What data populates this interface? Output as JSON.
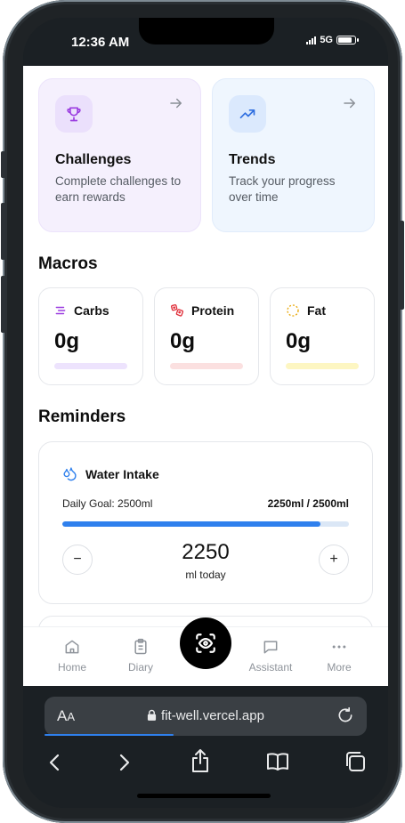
{
  "status": {
    "time": "12:36 AM",
    "network": "5G"
  },
  "features": [
    {
      "title": "Challenges",
      "description": "Complete challenges to earn rewards",
      "icon": "trophy-icon",
      "color": "#9b3ce0"
    },
    {
      "title": "Trends",
      "description": "Track your progress over time",
      "icon": "trending-up-icon",
      "color": "#2f6fe0"
    }
  ],
  "macros": {
    "title": "Macros",
    "items": [
      {
        "label": "Carbs",
        "value": "0g",
        "icon": "carbs-icon",
        "color": "#9b3ce0",
        "bar": "#ede3fd"
      },
      {
        "label": "Protein",
        "value": "0g",
        "icon": "protein-icon",
        "color": "#e0303b",
        "bar": "#fbe0e0"
      },
      {
        "label": "Fat",
        "value": "0g",
        "icon": "fat-icon",
        "color": "#e9a90b",
        "bar": "#fdf6c2"
      }
    ]
  },
  "reminders": {
    "title": "Reminders",
    "water": {
      "label": "Water Intake",
      "goal": "Daily Goal: 2500ml",
      "amount": "2250ml / 2500ml",
      "progress": 0.9,
      "value": "2250",
      "unit": "ml today",
      "minus": "−",
      "plus": "+"
    }
  },
  "nav": {
    "home": "Home",
    "diary": "Diary",
    "assistant": "Assistant",
    "more": "More"
  },
  "browser": {
    "aa_big": "A",
    "aa_small": "A",
    "url": "fit-well.vercel.app"
  }
}
